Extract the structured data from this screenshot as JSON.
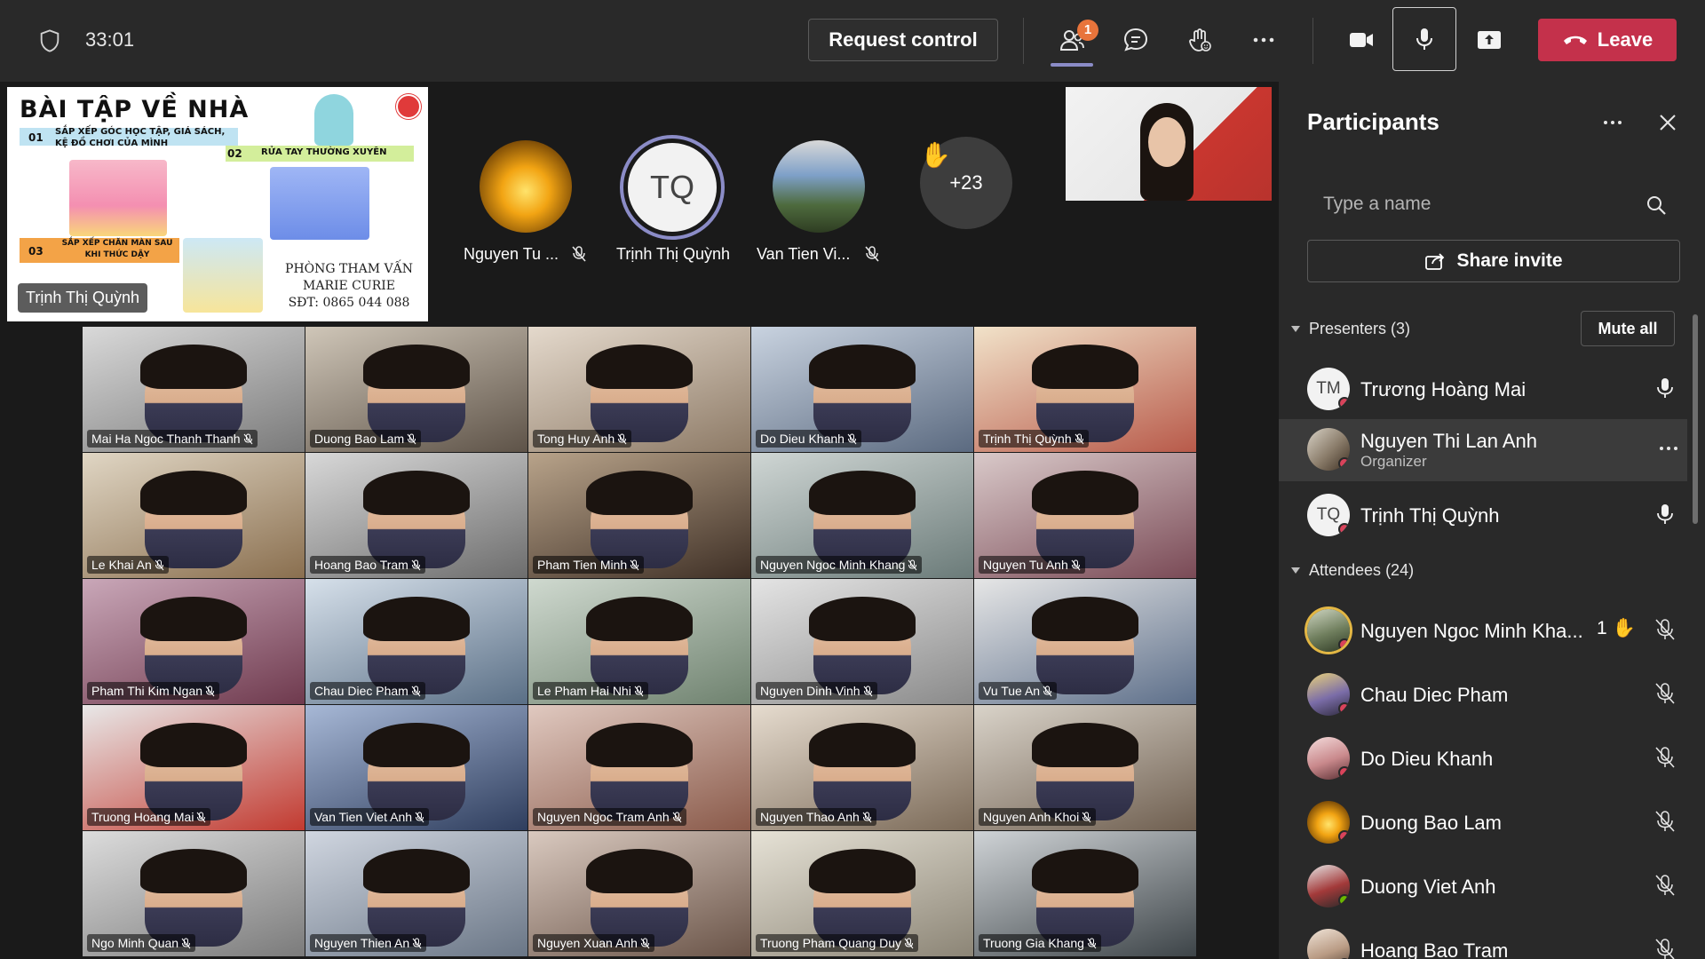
{
  "topbar": {
    "timer": "33:01",
    "request_control": "Request control",
    "people_badge": "1",
    "leave_label": "Leave",
    "colors": {
      "leave": "#c4314b",
      "badge": "#e8743b",
      "accent": "#8b8cc7"
    }
  },
  "shared_content": {
    "title": "BÀI TẬP VỀ NHÀ",
    "items": [
      {
        "num": "01",
        "text": "SẮP XẾP GÓC HỌC TẬP, GIÁ SÁCH, KỆ ĐỒ CHƠI CỦA MÌNH"
      },
      {
        "num": "02",
        "text": "RỬA TAY THƯỜNG XUYÊN"
      },
      {
        "num": "03",
        "text": "SẮP XẾP CHĂN MÀN SAU KHI THỨC DẬY"
      }
    ],
    "contact": [
      "PHÒNG THAM VẤN",
      "MARIE CURIE",
      "SĐT: 0865 044 088"
    ],
    "presenter": "Trịnh Thị Quỳnh"
  },
  "top_participants": [
    {
      "name": "Nguyen Tu ...",
      "muted": true,
      "avatar": "golden-egg"
    },
    {
      "name": "Trịnh Thị Quỳnh",
      "initials": "TQ",
      "muted": false,
      "speaking": true
    },
    {
      "name": "Van Tien Vi...",
      "muted": true,
      "avatar": "roblox"
    }
  ],
  "more_count": "+23",
  "grid": [
    "Mai Ha Ngoc Thanh Thanh",
    "Duong Bao Lam",
    "Tong Huy Anh",
    "Do Dieu Khanh",
    "Trịnh Thị Quỳnh",
    "Le Khai An",
    "Hoang Bao Tram",
    "Pham Tien Minh",
    "Nguyen Ngoc Minh Khang",
    "Nguyen Tu Anh",
    "Pham Thi Kim Ngan",
    "Chau Diec Pham",
    "Le Pham Hai Nhi",
    "Nguyen Dinh Vinh",
    "Vu Tue An",
    "Truong Hoang Mai",
    "Van Tien Viet Anh",
    "Nguyen Ngoc Tram Anh",
    "Nguyen Thao Anh",
    "Nguyen Anh Khoi",
    "Ngo Minh Quan",
    "Nguyen Thien An",
    "Nguyen Xuan Anh",
    "Truong Pham Quang Duy",
    "Truong Gia Khang"
  ],
  "panel": {
    "title": "Participants",
    "search_placeholder": "Type a name",
    "share_invite": "Share invite",
    "mute_all": "Mute all",
    "presenters_label": "Presenters (3)",
    "attendees_label": "Attendees (24)",
    "presenters": [
      {
        "name": "Trương Hoàng Mai",
        "initials": "TM",
        "mic": "on"
      },
      {
        "name": "Nguyen Thi Lan Anh",
        "role": "Organizer",
        "mic": "none",
        "photo": true
      },
      {
        "name": "Trịnh Thị Quỳnh",
        "initials": "TQ",
        "mic": "on"
      }
    ],
    "attendees": [
      {
        "name": "Nguyen Ngoc Minh Kha...",
        "raised_hand": "1",
        "mic": "off"
      },
      {
        "name": "Chau Diec Pham",
        "mic": "off"
      },
      {
        "name": "Do Dieu Khanh",
        "mic": "off"
      },
      {
        "name": "Duong Bao Lam",
        "mic": "off"
      },
      {
        "name": "Duong Viet Anh",
        "mic": "off"
      },
      {
        "name": "Hoang Bao Tram",
        "mic": "off"
      }
    ]
  }
}
